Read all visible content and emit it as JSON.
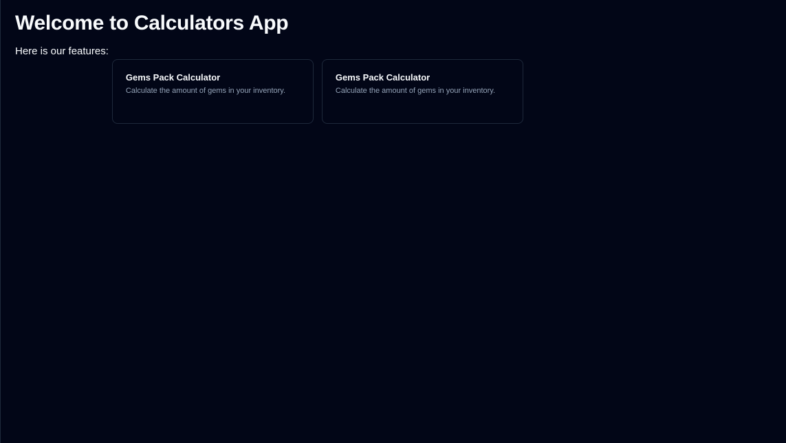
{
  "header": {
    "title": "Welcome to Calculators App"
  },
  "main": {
    "features_label": "Here is our features:",
    "cards": [
      {
        "title": "Gems Pack Calculator",
        "description": "Calculate the amount of gems in your inventory."
      },
      {
        "title": "Gems Pack Calculator",
        "description": "Calculate the amount of gems in your inventory."
      }
    ]
  },
  "colors": {
    "background": "#020617",
    "card_border": "#1e293b",
    "text": "#f8fafc",
    "muted_text": "#94a3b8"
  }
}
